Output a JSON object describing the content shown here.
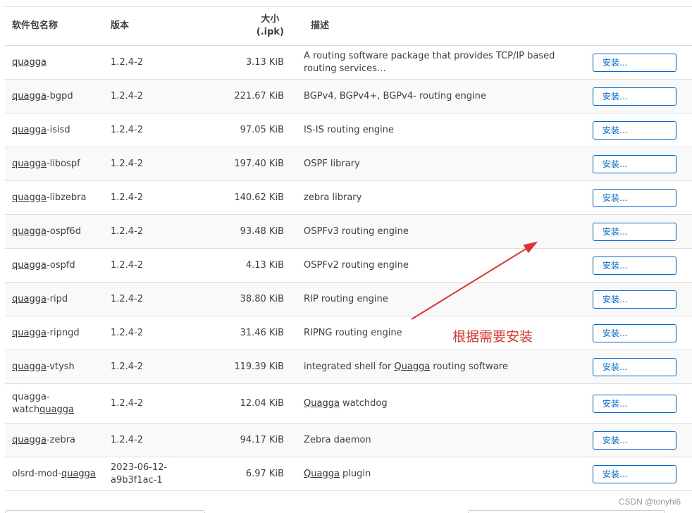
{
  "table": {
    "headers": {
      "name": "软件包名称",
      "version": "版本",
      "size_line1": "大小",
      "size_line2": "(.ipk)",
      "description": "描述"
    },
    "rows": [
      {
        "name_link": "quagga",
        "name_rest": "",
        "version": "1.2.4-2",
        "size": "3.13 KiB",
        "desc": "A routing software package that provides TCP/IP based routing services…",
        "action": "安装…"
      },
      {
        "name_link": "quagga",
        "name_rest": "-bgpd",
        "version": "1.2.4-2",
        "size": "221.67 KiB",
        "desc": "BGPv4, BGPv4+, BGPv4- routing engine",
        "action": "安装…"
      },
      {
        "name_link": "quagga",
        "name_rest": "-isisd",
        "version": "1.2.4-2",
        "size": "97.05 KiB",
        "desc": "IS-IS routing engine",
        "action": "安装…"
      },
      {
        "name_link": "quagga",
        "name_rest": "-libospf",
        "version": "1.2.4-2",
        "size": "197.40 KiB",
        "desc": "OSPF library",
        "action": "安装…"
      },
      {
        "name_link": "quagga",
        "name_rest": "-libzebra",
        "version": "1.2.4-2",
        "size": "140.62 KiB",
        "desc": "zebra library",
        "action": "安装…"
      },
      {
        "name_link": "quagga",
        "name_rest": "-ospf6d",
        "version": "1.2.4-2",
        "size": "93.48 KiB",
        "desc": "OSPFv3 routing engine",
        "action": "安装…"
      },
      {
        "name_link": "quagga",
        "name_rest": "-ospfd",
        "version": "1.2.4-2",
        "size": "4.13 KiB",
        "desc": "OSPFv2 routing engine",
        "action": "安装…"
      },
      {
        "name_link": "quagga",
        "name_rest": "-ripd",
        "version": "1.2.4-2",
        "size": "38.80 KiB",
        "desc": "RIP routing engine",
        "action": "安装…"
      },
      {
        "name_link": "quagga",
        "name_rest": "-ripngd",
        "version": "1.2.4-2",
        "size": "31.46 KiB",
        "desc": "RIPNG routing engine",
        "action": "安装…"
      },
      {
        "name_link": "quagga",
        "name_rest": "-vtysh",
        "version": "1.2.4-2",
        "size": "119.39 KiB",
        "desc_pre": "integrated shell for ",
        "desc_link": "Quagga",
        "desc_post": " routing software",
        "action": "安装…"
      },
      {
        "name_pre_line1": "quagga-",
        "name_pre_line2": "watch",
        "name_link": "quagga",
        "version": "1.2.4-2",
        "size": "12.04 KiB",
        "desc_link": "Quagga",
        "desc_post": " watchdog",
        "action": "安装…"
      },
      {
        "name_link": "quagga",
        "name_rest": "-zebra",
        "version": "1.2.4-2",
        "size": "94.17 KiB",
        "desc": "Zebra daemon",
        "action": "安装…"
      },
      {
        "name_pre": "olsrd-mod-",
        "name_link": "quagga",
        "version": "2023-06-12-a9b3f1ac-1",
        "size": "6.97 KiB",
        "desc_link": "Quagga",
        "desc_post": " plugin",
        "action": "安装…"
      }
    ]
  },
  "annotation": {
    "text": "根据需要安装",
    "color": "#e0332d"
  },
  "watermark": "CSDN @tonyhi6",
  "colors": {
    "button_border": "#0069d6",
    "row_alt": "#f9f9f9",
    "border": "#dddddd"
  }
}
